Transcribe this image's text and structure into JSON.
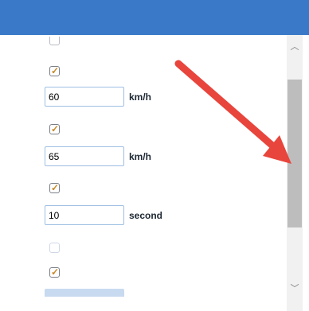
{
  "fields": [
    {
      "id": "field-1",
      "value": "60",
      "unit": "km/h"
    },
    {
      "id": "field-2",
      "value": "65",
      "unit": "km/h"
    },
    {
      "id": "field-3",
      "value": "10",
      "unit": "second"
    }
  ],
  "checkboxes": [
    {
      "id": "cb-0",
      "checked": false
    },
    {
      "id": "cb-1",
      "checked": true
    },
    {
      "id": "cb-2",
      "checked": true
    },
    {
      "id": "cb-3",
      "checked": true
    },
    {
      "id": "cb-4",
      "checked": false
    },
    {
      "id": "cb-5",
      "checked": true
    }
  ],
  "scrollbar": {
    "up_glyph": "︿",
    "down_glyph": "﹀"
  },
  "annotation": {
    "color": "#e8453c"
  },
  "colors": {
    "header": "#3a79c7",
    "check": "#c88a2a",
    "input_border": "#9fbfe3"
  }
}
